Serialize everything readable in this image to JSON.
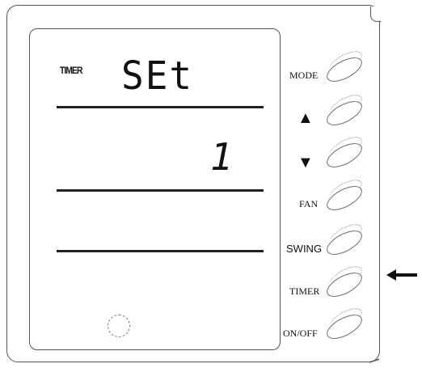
{
  "display": {
    "timer_indicator": "TIMER",
    "main_text": "SEt",
    "value_text": "1"
  },
  "buttons": [
    {
      "label": "MODE"
    },
    {
      "label": "▲",
      "icon": "up-arrow-icon"
    },
    {
      "label": "▼",
      "icon": "down-arrow-icon"
    },
    {
      "label": "FAN"
    },
    {
      "label": "SWING"
    },
    {
      "label": "TIMER"
    },
    {
      "label": "ON/OFF"
    }
  ],
  "colors": {
    "ink": "#111111",
    "outline": "#555555"
  }
}
